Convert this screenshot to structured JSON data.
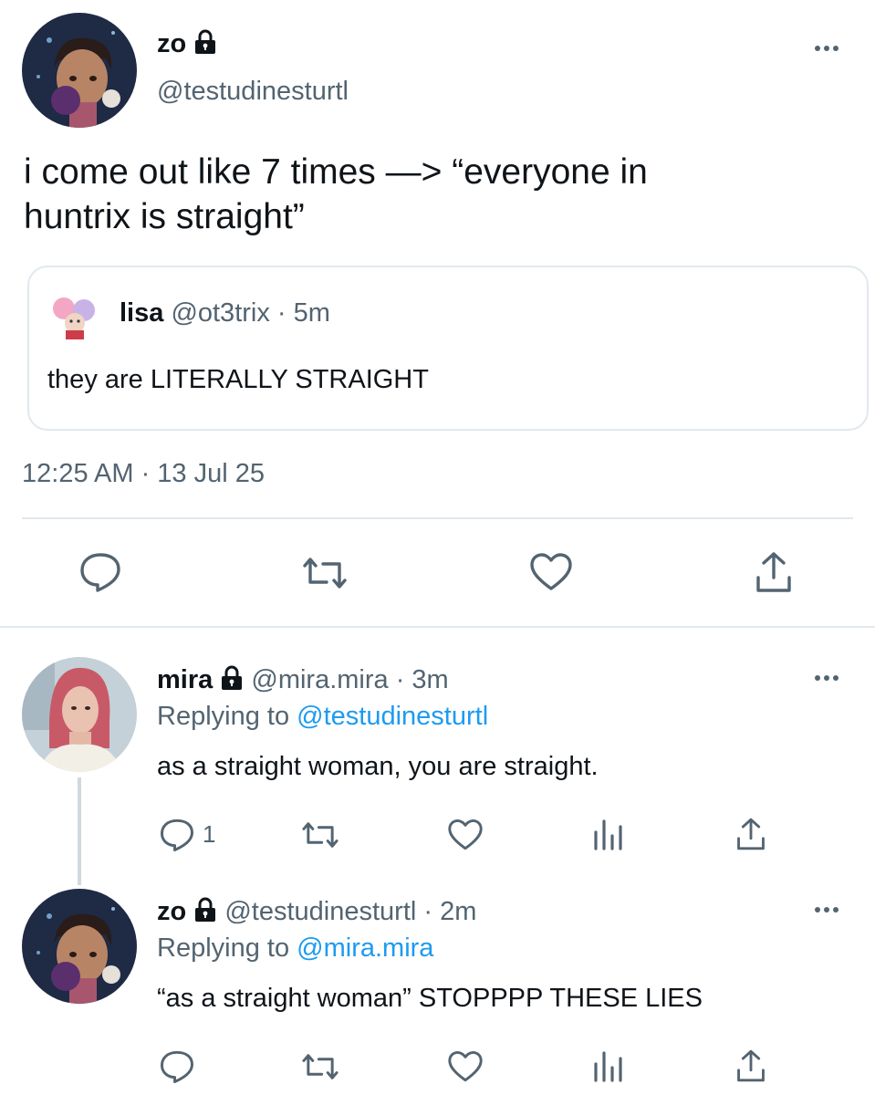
{
  "main_tweet": {
    "display_name": "zo",
    "handle": "@testudinesturtl",
    "text_line1": "i come out like 7 times —> “everyone in",
    "text_line2": "huntrix is straight”",
    "quote": {
      "display_name": "lisa",
      "handle": "@ot3trix",
      "time": "· 5m",
      "text": "they are LITERALLY STRAIGHT"
    },
    "timestamp": "12:25 AM · 13 Jul 25"
  },
  "replies": [
    {
      "display_name": "mira",
      "handle_time": "@mira.mira · 3m",
      "replying_prefix": "Replying to",
      "replying_to": "@testudinesturtl",
      "text": "as a straight woman, you are straight.",
      "reply_count": "1"
    },
    {
      "display_name": "zo",
      "handle_time": "@testudinesturtl · 2m",
      "replying_prefix": "Replying to",
      "replying_to": "@mira.mira",
      "text": "“as a straight woman” STOPPPP THESE LIES",
      "reply_count": ""
    }
  ],
  "colors": {
    "text": "#0f1419",
    "secondary": "#536471",
    "link": "#1d9bf0",
    "divider": "#e1e8ed"
  },
  "icons": [
    "lock-icon",
    "more-icon",
    "reply-icon",
    "retweet-icon",
    "like-icon",
    "share-icon",
    "analytics-icon"
  ]
}
